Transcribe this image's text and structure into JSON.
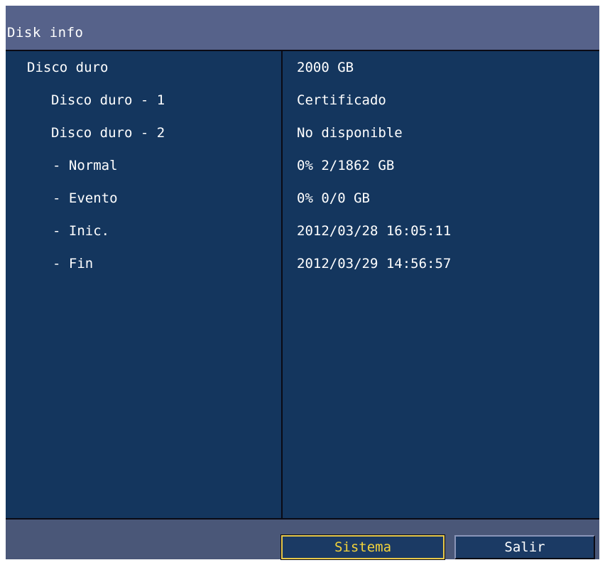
{
  "window": {
    "title": "Disk info"
  },
  "rows": [
    {
      "label": "Disco duro",
      "value": "2000 GB"
    },
    {
      "label": "Disco duro - 1",
      "value": "Certificado"
    },
    {
      "label": "Disco duro - 2",
      "value": "No disponible"
    },
    {
      "label": "- Normal",
      "value": "0% 2/1862 GB"
    },
    {
      "label": "- Evento",
      "value": "0% 0/0 GB"
    },
    {
      "label": "- Inic.",
      "value": "2012/03/28 16:05:11"
    },
    {
      "label": "- Fin",
      "value": "2012/03/29 14:56:57"
    }
  ],
  "buttons": {
    "sistema": "Sistema",
    "salir": "Salir"
  },
  "colors": {
    "panel_bg": "#14365e",
    "title_bg": "#56628a",
    "focus_text": "#f2d23a",
    "focus_border": "#e8c84a"
  }
}
